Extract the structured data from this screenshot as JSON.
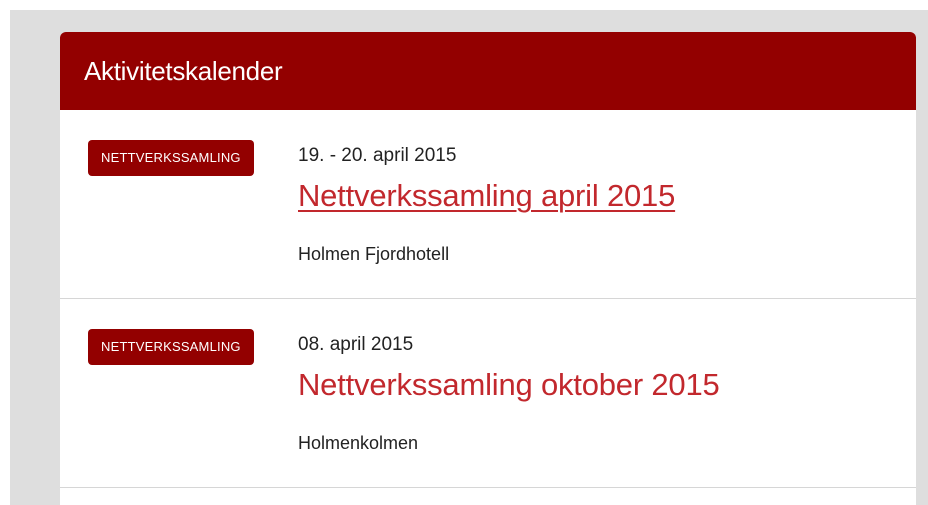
{
  "panel": {
    "title": "Aktivitetskalender"
  },
  "events": [
    {
      "category": "NETTVERKSSAMLING",
      "date": "19. - 20. april 2015",
      "title": "Nettverkssamling april 2015",
      "location": "Holmen Fjordhotell",
      "hovered": true
    },
    {
      "category": "NETTVERKSSAMLING",
      "date": "08. april 2015",
      "title": "Nettverkssamling oktober 2015",
      "location": "Holmenkolmen",
      "hovered": false
    }
  ],
  "colors": {
    "brand": "#930000",
    "link": "#c2282d",
    "page_background": "#dedede",
    "divider": "#d6d6d6"
  }
}
